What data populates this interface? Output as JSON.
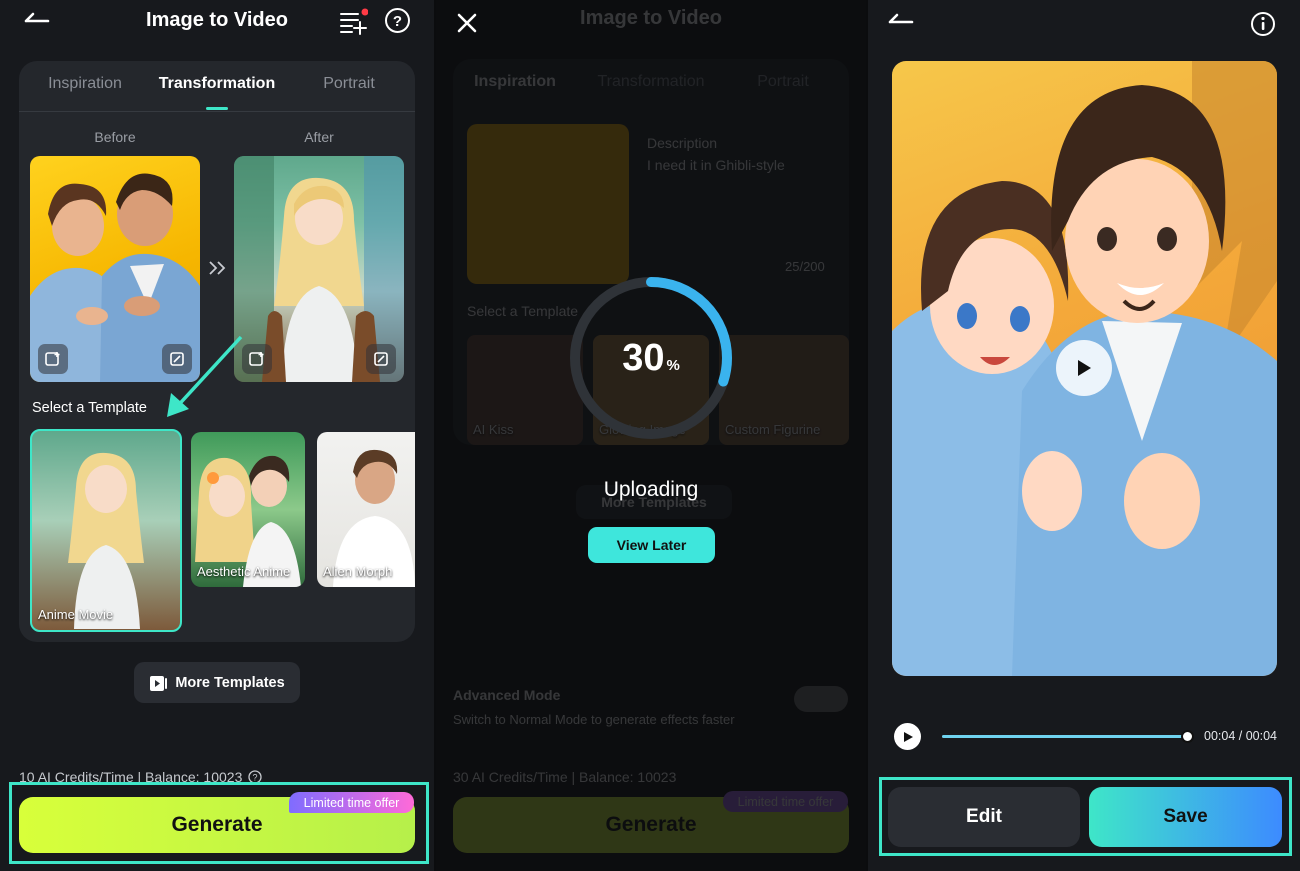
{
  "colors": {
    "accent": "#3ee6c8",
    "generate_start": "#d8ff3a",
    "generate_end": "#b6f04a",
    "offer_start": "#7f6cff",
    "offer_end": "#ff6ad8",
    "save_start": "#3ee6c8",
    "save_end": "#3d8bff",
    "progress": "#3ab3ee"
  },
  "screen1": {
    "title": "Image to Video",
    "tabs": [
      "Inspiration",
      "Transformation",
      "Portrait"
    ],
    "before_label": "Before",
    "after_label": "After",
    "select_template": "Select a Template",
    "templates": [
      "Anime Movie",
      "Aesthetic Anime",
      "Alien Morph"
    ],
    "more_templates": "More Templates",
    "credits": "10 AI Credits/Time | Balance: 10023",
    "offer_badge": "Limited time offer",
    "generate": "Generate"
  },
  "screen2": {
    "title": "Image to Video",
    "tabs": [
      "Inspiration",
      "Transformation",
      "Portrait"
    ],
    "description_label": "Description",
    "description_text": "I need it in Ghibli-style",
    "char_count": "25/200",
    "select_template": "Select a Template",
    "templates": [
      "AI Kiss",
      "Glowing Image",
      "Custom Figurine"
    ],
    "more_templates": "More Templates",
    "advanced_mode": "Advanced Mode",
    "advanced_desc": "Switch to Normal Mode to generate effects faster",
    "credits": "30 AI Credits/Time | Balance: 10023",
    "offer_badge": "Limited time offer",
    "generate": "Generate",
    "progress_value": "30",
    "progress_unit": "%",
    "progress_fraction": 0.3,
    "status": "Uploading",
    "view_later": "View Later"
  },
  "screen3": {
    "time": "00:04 / 00:04",
    "playback_progress": 1.0,
    "edit": "Edit",
    "save": "Save"
  }
}
